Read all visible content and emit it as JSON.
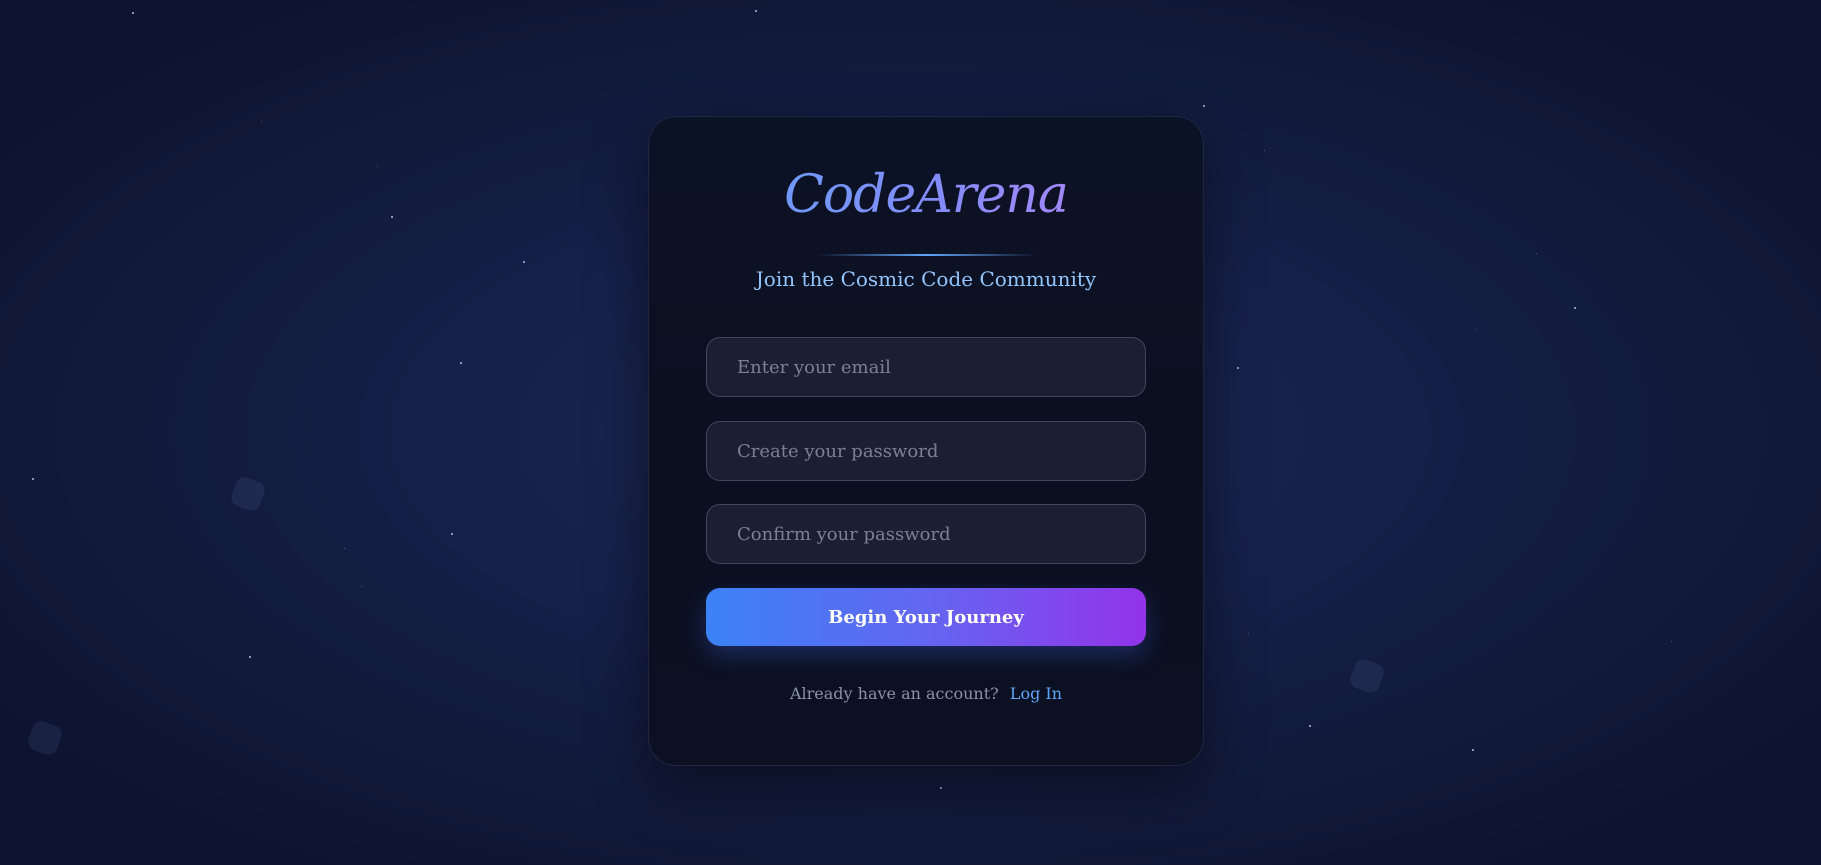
{
  "brand": {
    "logo_text": "CodeArena",
    "tagline": "Join the Cosmic Code Community"
  },
  "form": {
    "email_placeholder": "Enter your email",
    "password_placeholder": "Create your password",
    "confirm_placeholder": "Confirm your password",
    "submit_label": "Begin Your Journey"
  },
  "footer": {
    "prompt": "Already have an account?",
    "login_label": "Log In"
  },
  "colors": {
    "accent_blue": "#60a5fa",
    "accent_purple": "#9333ea",
    "background": "#16204a"
  }
}
